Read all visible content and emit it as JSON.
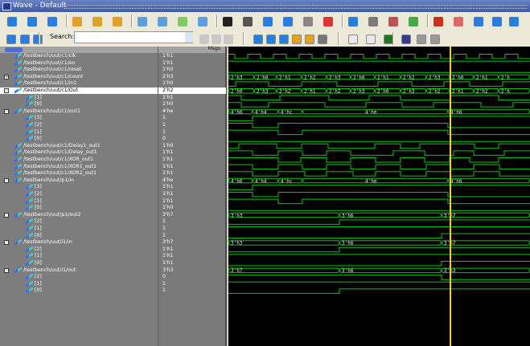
{
  "window": {
    "title": "Wave - Default"
  },
  "toolbar2": {
    "search_label": "Search:",
    "search_value": ""
  },
  "signal_panel": {
    "value_header": "Msgs"
  },
  "colors": {
    "wave_bg": "#000000",
    "signal": "#00cc00",
    "cursor": "#ffd400"
  },
  "rows": [
    {
      "name": "/testbench/uut/c1/clk",
      "value": "1'h1",
      "indent": 0,
      "expander": "",
      "selected": false
    },
    {
      "name": "/testbench/uut/c1/en",
      "value": "1'h1",
      "indent": 0,
      "expander": "",
      "selected": false
    },
    {
      "name": "/testbench/uut/c1/reset",
      "value": "1'h0",
      "indent": 0,
      "expander": "",
      "selected": false
    },
    {
      "name": "/testbench/uut/c1/count",
      "value": "2'h3",
      "indent": 0,
      "expander": "+",
      "selected": false
    },
    {
      "name": "/testbench/uut/c1/in1",
      "value": "1'h0",
      "indent": 0,
      "expander": "",
      "selected": false
    },
    {
      "name": "/testbench/uut/c1/Out",
      "value": "2'h2",
      "indent": 0,
      "expander": "-",
      "selected": true
    },
    {
      "name": "[1]",
      "value": "1'h1",
      "indent": 1,
      "expander": "",
      "selected": false
    },
    {
      "name": "[0]",
      "value": "1'h0",
      "indent": 1,
      "expander": "",
      "selected": false
    },
    {
      "name": "/testbench/uut/c1/out1",
      "value": "4'he",
      "indent": 0,
      "expander": "-",
      "selected": false
    },
    {
      "name": "[3]",
      "value": "1",
      "indent": 1,
      "expander": "",
      "selected": false
    },
    {
      "name": "[2]",
      "value": "1",
      "indent": 1,
      "expander": "",
      "selected": false
    },
    {
      "name": "[1]",
      "value": "1",
      "indent": 1,
      "expander": "",
      "selected": false
    },
    {
      "name": "[0]",
      "value": "0",
      "indent": 1,
      "expander": "",
      "selected": false
    },
    {
      "name": "/testbench/uut/c1/Delay1_out1",
      "value": "1'h0",
      "indent": 0,
      "expander": "",
      "selected": false
    },
    {
      "name": "/testbench/uut/c1/Delay_out1",
      "value": "1'h1",
      "indent": 0,
      "expander": "",
      "selected": false
    },
    {
      "name": "/testbench/uut/c1/XOR_out1",
      "value": "1'h1",
      "indent": 0,
      "expander": "",
      "selected": false
    },
    {
      "name": "/testbench/uut/c1/XOR1_out1",
      "value": "1'h1",
      "indent": 0,
      "expander": "",
      "selected": false
    },
    {
      "name": "/testbench/uut/c1/XOR2_out1",
      "value": "1'h1",
      "indent": 0,
      "expander": "",
      "selected": false
    },
    {
      "name": "/testbench/uut/p1/in",
      "value": "4'he",
      "indent": 0,
      "expander": "-",
      "selected": false
    },
    {
      "name": "[3]",
      "value": "1'h1",
      "indent": 1,
      "expander": "",
      "selected": false
    },
    {
      "name": "[2]",
      "value": "1'h1",
      "indent": 1,
      "expander": "",
      "selected": false
    },
    {
      "name": "[1]",
      "value": "1'h1",
      "indent": 1,
      "expander": "",
      "selected": false
    },
    {
      "name": "[0]",
      "value": "1'h0",
      "indent": 1,
      "expander": "",
      "selected": false
    },
    {
      "name": "/testbench/uut/p1/out2",
      "value": "3'h7",
      "indent": 0,
      "expander": "-",
      "selected": false
    },
    {
      "name": "[2]",
      "value": "1",
      "indent": 1,
      "expander": "",
      "selected": false
    },
    {
      "name": "[1]",
      "value": "1",
      "indent": 1,
      "expander": "",
      "selected": false
    },
    {
      "name": "[0]",
      "value": "1",
      "indent": 1,
      "expander": "",
      "selected": false
    },
    {
      "name": "/testbench/uut/i1/in",
      "value": "3'h7",
      "indent": 0,
      "expander": "-",
      "selected": false
    },
    {
      "name": "[2]",
      "value": "1'h1",
      "indent": 1,
      "expander": "",
      "selected": false
    },
    {
      "name": "[1]",
      "value": "1'h1",
      "indent": 1,
      "expander": "",
      "selected": false
    },
    {
      "name": "[0]",
      "value": "1'h1",
      "indent": 1,
      "expander": "",
      "selected": false
    },
    {
      "name": "/testbench/uut/i1/out",
      "value": "3'h3",
      "indent": 0,
      "expander": "-",
      "selected": false
    },
    {
      "name": "[2]",
      "value": "0",
      "indent": 1,
      "expander": "",
      "selected": false
    },
    {
      "name": "[1]",
      "value": "1",
      "indent": 1,
      "expander": "",
      "selected": false
    },
    {
      "name": "[0]",
      "value": "1",
      "indent": 1,
      "expander": "",
      "selected": false
    }
  ],
  "bus_labels": {
    "count": [
      "2'h3",
      "2'h0",
      "2'h1",
      "2'h2",
      "2'h3",
      "2'h0",
      "2'h1",
      "2'h2",
      "2'h3",
      "2'h0",
      "2'h1",
      "2'h"
    ],
    "Out": [
      "2'h0",
      "2'h3",
      "2'h2",
      "2'h1",
      "2'h2",
      "2'h3",
      "2'h0",
      "2'h3",
      "2'h2",
      "2'h1",
      "2'h2",
      "2'h"
    ],
    "out1": [
      "4'h6",
      "4'h4",
      "4'hc",
      "4'he",
      "4'h6"
    ],
    "p1_in": [
      "4'h6",
      "4'h4",
      "4'hc",
      "4'he",
      "4'h6"
    ],
    "p1_out2": [
      "3'h3",
      "3'h6",
      "3'h7"
    ],
    "i1_in": [
      "3'h3",
      "3'h6",
      "3'h7"
    ],
    "i1_out": [
      "3'h7",
      "3'h6",
      "3'h3"
    ]
  },
  "toolbar_icons": [
    "insert-icon",
    "up-icon",
    "up-arrow-icon",
    "zoom-fit-icon",
    "zoom-region-icon",
    "align-icon",
    "wave-edit-icon",
    "wave-split-icon",
    "wave-merge-icon",
    "wave-invert-icon",
    "pointer-icon",
    "select-icon",
    "cursor-icon",
    "marker-icon",
    "scale-icon",
    "break-icon",
    "find-icon",
    "time-icon",
    "cursor-link-icon",
    "bookmark-icon",
    "dataflow-icon",
    "zoom-dropdown-icon",
    "back-icon",
    "forward-icon",
    "expand-icon"
  ],
  "toolbar2_icons": [
    "step-icon",
    "step-over-icon",
    "step-back-icon",
    "search-dropdown-icon",
    "find-next-icon",
    "find-prev-icon",
    "zoom-in-icon",
    "zoom-out-icon",
    "zoom-full-icon",
    "zoom-cursor-icon",
    "zoom-last-icon",
    "zoom-region2-icon",
    "layout-1-icon",
    "layout-2-icon",
    "layout-3-icon",
    "wave-format-1-icon",
    "wave-format-2-icon",
    "wave-format-3-icon"
  ]
}
